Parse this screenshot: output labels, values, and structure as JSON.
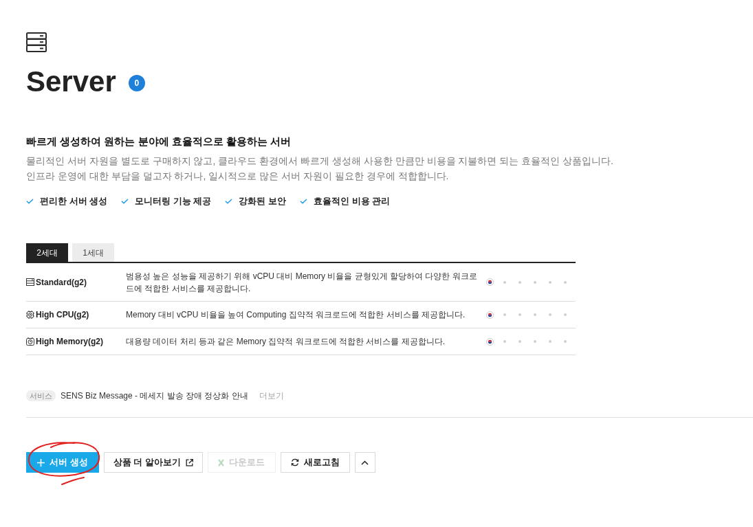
{
  "header": {
    "title": "Server",
    "count": "0"
  },
  "intro": {
    "heading": "빠르게 생성하여 원하는 분야에 효율적으로 활용하는 서버",
    "description": [
      "물리적인 서버 자원을 별도로 구매하지 않고, 클라우드 환경에서 빠르게 생성해 사용한 만큼만 비용을 지불하면 되는 효율적인 상품입니다.",
      "인프라 운영에 대한 부담을 덜고자 하거나, 일시적으로 많은 서버 자원이 필요한 경우에 적합합니다."
    ],
    "features": [
      "편리한 서버 생성",
      "모니터링 기능 제공",
      "강화된 보안",
      "효율적인 비용 관리"
    ]
  },
  "tabs": [
    {
      "label": "2세대",
      "selected": true
    },
    {
      "label": "1세대",
      "selected": false
    }
  ],
  "table": {
    "rows": [
      {
        "kind": "standard",
        "name": "Standard(g2)",
        "description": "범용성 높은 성능을 제공하기 위해 vCPU 대비 Memory 비율을 균형있게 할당하여 다양한 워크로드에 적합한 서비스를 제공합니다.",
        "regions": [
          {
            "available": true
          },
          {
            "available": false
          },
          {
            "available": false
          },
          {
            "available": false
          },
          {
            "available": false
          },
          {
            "available": false
          }
        ]
      },
      {
        "kind": "cpu",
        "name": "High CPU(g2)",
        "description": "Memory 대비 vCPU 비율을 높여 Computing 집약적 워크로드에 적합한 서비스를 제공합니다.",
        "regions": [
          {
            "available": true
          },
          {
            "available": false
          },
          {
            "available": false
          },
          {
            "available": false
          },
          {
            "available": false
          },
          {
            "available": false
          }
        ]
      },
      {
        "kind": "memory",
        "name": "High Memory(g2)",
        "description": "대용량 데이터 처리 등과 같은 Memory 집약적 워크로드에 적합한 서비스를 제공합니다.",
        "regions": [
          {
            "available": true
          },
          {
            "available": false
          },
          {
            "available": false
          },
          {
            "available": false
          },
          {
            "available": false
          },
          {
            "available": false
          }
        ]
      }
    ]
  },
  "notice": {
    "tag": "서비스",
    "text": "SENS Biz Message - 메세지 발송 장애 정상화 안내",
    "link": "더보기"
  },
  "buttons": [
    {
      "kind": "create",
      "label": "서버 생성",
      "disabled": false
    },
    {
      "kind": "external",
      "label": "상품 더 알아보기",
      "disabled": false
    },
    {
      "kind": "download",
      "label": "다운로드",
      "disabled": true
    },
    {
      "kind": "refresh",
      "label": "새로고침",
      "disabled": false
    },
    {
      "kind": "collapse",
      "disabled": false
    }
  ]
}
